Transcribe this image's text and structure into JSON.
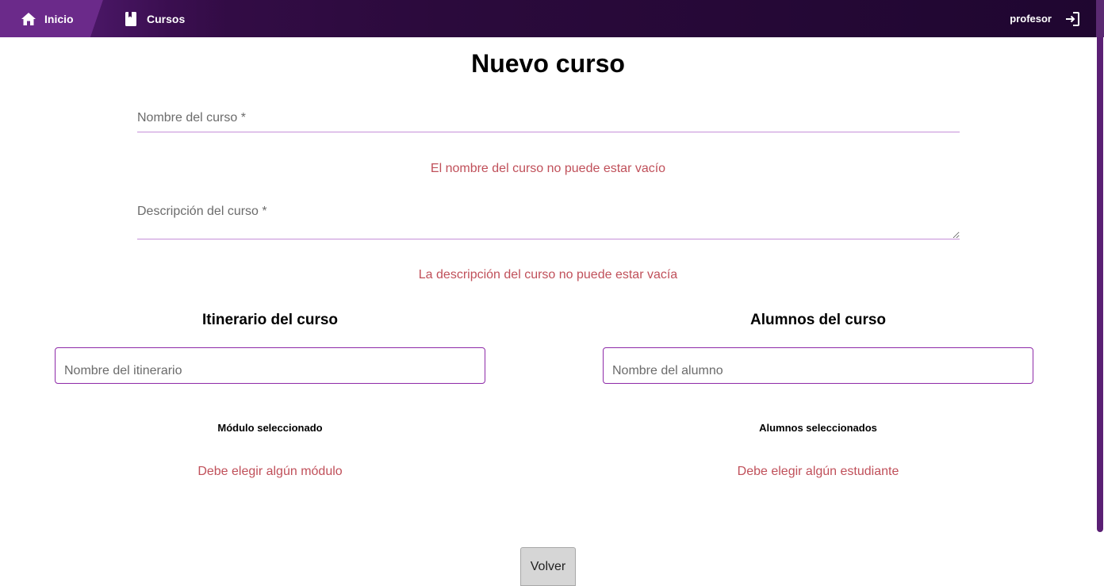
{
  "navbar": {
    "home_label": "Inicio",
    "courses_label": "Cursos",
    "username": "profesor",
    "home_icon": "home-icon",
    "courses_icon": "book-icon",
    "logout_icon": "logout-icon"
  },
  "page": {
    "title": "Nuevo curso"
  },
  "form": {
    "name_placeholder": "Nombre del curso *",
    "name_value": "",
    "name_error": "El nombre del curso no puede estar vacío",
    "description_placeholder": "Descripción del curso *",
    "description_value": "",
    "description_error": "La descripción del curso no puede estar vacía"
  },
  "itinerary": {
    "title": "Itinerario del curso",
    "search_placeholder": "Nombre del itinerario",
    "selected_title": "Módulo seleccionado",
    "error": "Debe elegir algún módulo"
  },
  "students": {
    "title": "Alumnos del curso",
    "search_placeholder": "Nombre del alumno",
    "selected_title": "Alumnos seleccionados",
    "error": "Debe elegir algún estudiante"
  },
  "actions": {
    "back_label": "Volver"
  },
  "colors": {
    "nav_dark": "#2b0a3c",
    "nav_active": "#6b2a8a",
    "accent": "#8e2aa8",
    "error": "#c0505a"
  }
}
